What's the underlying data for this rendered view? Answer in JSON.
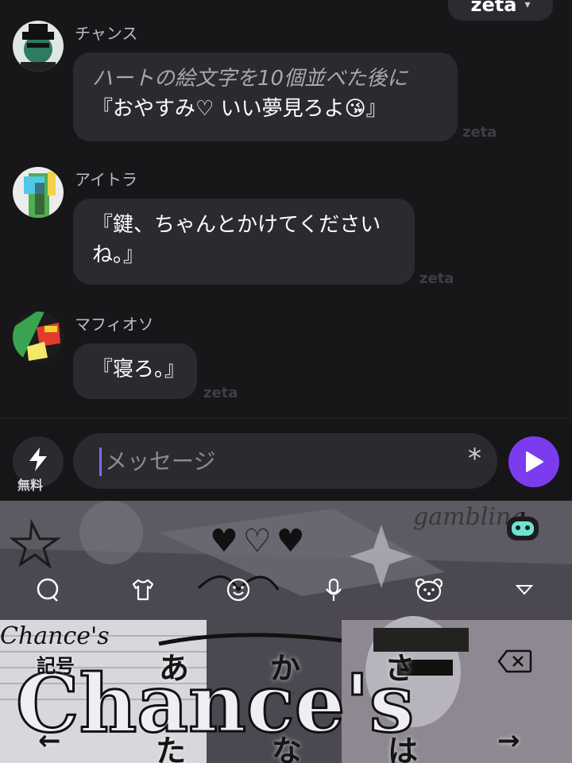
{
  "header": {
    "zeta_label": "zeta",
    "chevron_icon": "chevron-down-icon"
  },
  "messages": [
    {
      "name": "チャンス",
      "narration": "ハートの絵文字を10個並べた後に",
      "text": "『おやすみ♡ いい夢見ろよ😘』",
      "watermark": "zeta"
    },
    {
      "name": "アイトラ",
      "text": "『鍵、ちゃんとかけてくださいね。』",
      "watermark": "zeta"
    },
    {
      "name": "マフィオソ",
      "text": "『寝ろ。』",
      "watermark": "zeta"
    }
  ],
  "composer": {
    "free_label": "無料",
    "placeholder": "メッセージ",
    "star_glyph": "*",
    "bolt_icon": "lightning-icon",
    "send_icon": "send-icon",
    "accent": "#7b3cf0"
  },
  "keyboard": {
    "hearts": "♥♡♥",
    "tools": [
      "chat-bubble-icon",
      "shirt-icon",
      "emoji-icon",
      "mic-icon",
      "bear-icon",
      "collapse-icon"
    ],
    "symbol_key": "記号",
    "row1": [
      "あ",
      "か",
      "さ"
    ],
    "row2": [
      "た",
      "な",
      "は"
    ],
    "left_arrow": "←",
    "right_arrow": "→",
    "backspace_icon": "backspace-icon",
    "art_text": "Chance's"
  }
}
